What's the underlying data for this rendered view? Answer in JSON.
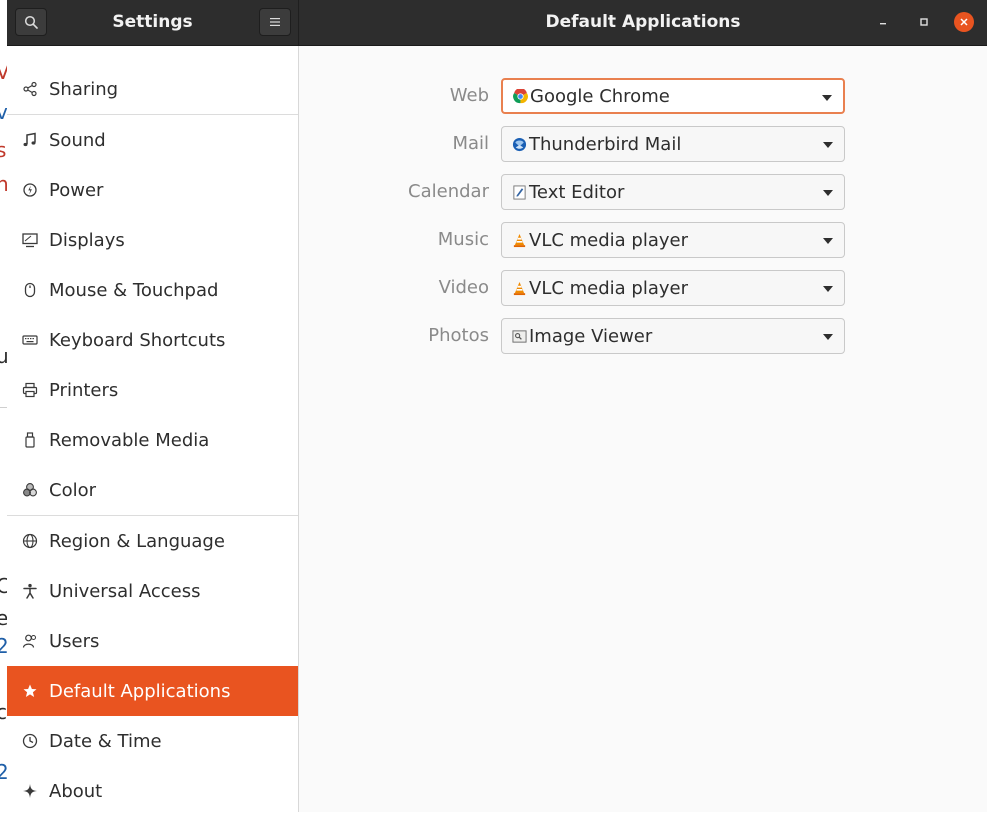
{
  "background_fragments": [
    "V",
    "v",
    "s",
    "n",
    "u",
    "C",
    "e",
    "2",
    "c",
    "2"
  ],
  "headerbar": {
    "left_title": "Settings",
    "right_title": "Default Applications",
    "search_icon": "search-icon",
    "menu_icon": "hamburger-icon",
    "close_color": "#e95420"
  },
  "sidebar": {
    "accent": "#e95420",
    "items": [
      {
        "label": "Sharing",
        "icon": "share-icon"
      },
      {
        "label": "Sound",
        "icon": "music-note-icon"
      },
      {
        "label": "Power",
        "icon": "power-icon"
      },
      {
        "label": "Displays",
        "icon": "display-icon"
      },
      {
        "label": "Mouse & Touchpad",
        "icon": "mouse-icon"
      },
      {
        "label": "Keyboard Shortcuts",
        "icon": "keyboard-icon"
      },
      {
        "label": "Printers",
        "icon": "printer-icon"
      },
      {
        "label": "Removable Media",
        "icon": "usb-drive-icon"
      },
      {
        "label": "Color",
        "icon": "color-circles-icon"
      },
      {
        "label": "Region & Language",
        "icon": "globe-icon"
      },
      {
        "label": "Universal Access",
        "icon": "accessibility-icon"
      },
      {
        "label": "Users",
        "icon": "users-icon"
      },
      {
        "label": "Default Applications",
        "icon": "star-icon",
        "active": true
      },
      {
        "label": "Date & Time",
        "icon": "clock-icon"
      },
      {
        "label": "About",
        "icon": "sparkle-icon"
      }
    ]
  },
  "defaults": [
    {
      "label": "Web",
      "value": "Google Chrome",
      "icon": "chrome-icon",
      "focused": true
    },
    {
      "label": "Mail",
      "value": "Thunderbird Mail",
      "icon": "thunderbird-icon"
    },
    {
      "label": "Calendar",
      "value": "Text Editor",
      "icon": "text-editor-icon"
    },
    {
      "label": "Music",
      "value": "VLC media player",
      "icon": "vlc-icon"
    },
    {
      "label": "Video",
      "value": "VLC media player",
      "icon": "vlc-icon"
    },
    {
      "label": "Photos",
      "value": "Image Viewer",
      "icon": "image-viewer-icon"
    }
  ]
}
